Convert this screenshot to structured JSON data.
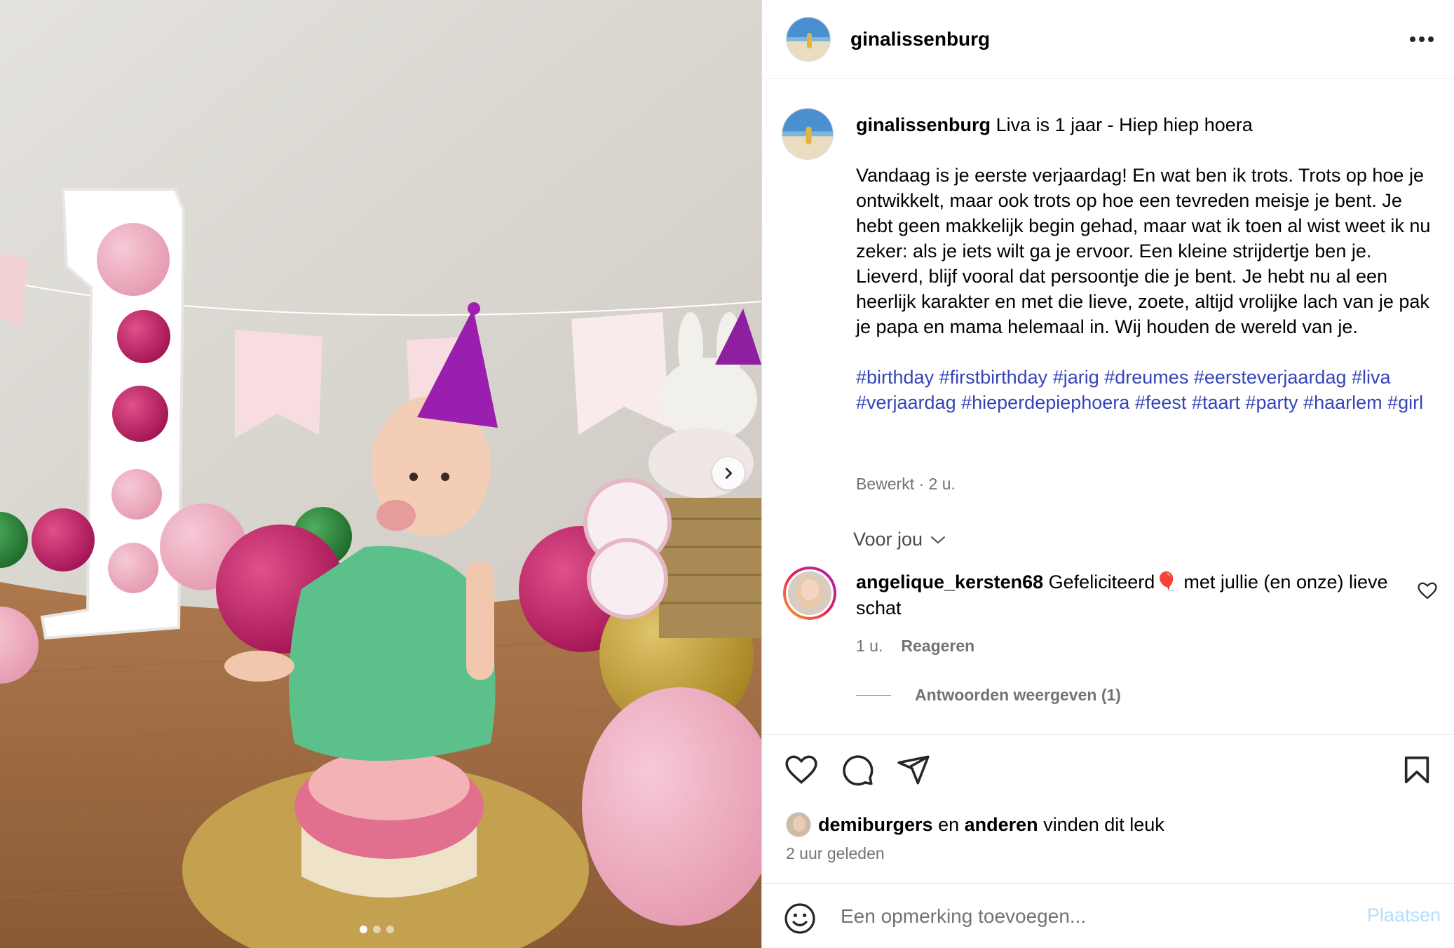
{
  "header": {
    "username": "ginalissenburg"
  },
  "caption": {
    "username": "ginalissenburg",
    "title": "Liva is 1 jaar - Hiep hiep hoera",
    "body": "Vandaag is je eerste verjaardag! En wat ben ik trots. Trots op hoe je ontwikkelt, maar ook trots op hoe een tevreden meisje je bent. Je hebt geen makkelijk begin gehad, maar wat ik toen al wist weet ik nu zeker: als je iets wilt ga je ervoor. Een kleine strijdertje ben je. Lieverd, blijf vooral dat persoontje die je bent. Je hebt nu al een heerlijk karakter en met die lieve, zoete, altijd vrolijke lach van je pak je papa en mama helemaal in. Wij houden de wereld van je.",
    "hashtags": [
      "#birthday",
      "#firstbirthday",
      "#jarig",
      "#dreumes",
      "#eersteverjaardag",
      "#liva",
      "#verjaardag",
      "#hieperdepiephoera",
      "#feest",
      "#taart",
      "#party",
      "#haarlem",
      "#girl"
    ],
    "meta": "Bewerkt · 2 u."
  },
  "voor_jou": "Voor jou",
  "comment": {
    "username": "angelique_kersten68",
    "text_before": "Gefeliciteerd",
    "emoji": "🎈",
    "text_after": "met jullie (en onze) lieve schat",
    "time": "1 u.",
    "reply_label": "Reageren",
    "view_replies": "Antwoorden weergeven (1)"
  },
  "likes": {
    "user": "demiburgers",
    "connector": "en",
    "others": "anderen",
    "suffix": "vinden dit leuk"
  },
  "timestamp": "2 uur geleden",
  "add_comment": {
    "placeholder": "Een opmerking toevoegen...",
    "post_label": "Plaatsen"
  },
  "carousel": {
    "slides": 3,
    "active": 1
  },
  "colors": {
    "hashtag": "#3445b8",
    "post_button_disabled": "#b2dffc",
    "secondary_text": "#737373"
  },
  "icons": [
    "more-icon",
    "heart-icon",
    "comment-icon",
    "share-icon",
    "bookmark-icon",
    "emoji-icon",
    "chevron-right-icon",
    "chevron-down-icon",
    "small-heart-icon"
  ]
}
